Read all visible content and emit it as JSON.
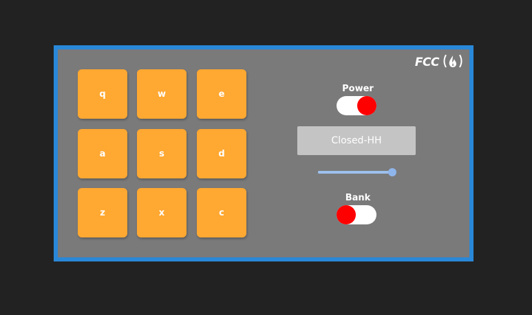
{
  "logo": {
    "text": "FCC",
    "icon": "fire-icon"
  },
  "pads": [
    {
      "key": "q"
    },
    {
      "key": "w"
    },
    {
      "key": "e"
    },
    {
      "key": "a"
    },
    {
      "key": "s"
    },
    {
      "key": "d"
    },
    {
      "key": "z"
    },
    {
      "key": "x"
    },
    {
      "key": "c"
    }
  ],
  "power": {
    "label": "Power",
    "on": true
  },
  "display": {
    "text": "Closed-HH"
  },
  "volume": {
    "value": 1.0
  },
  "bank": {
    "label": "Bank",
    "on": false
  },
  "colors": {
    "accent_border": "#2a88d8",
    "pad": "#ffa832",
    "toggle_knob": "#ff0000",
    "panel": "#7a7a7a",
    "background": "#222222"
  }
}
